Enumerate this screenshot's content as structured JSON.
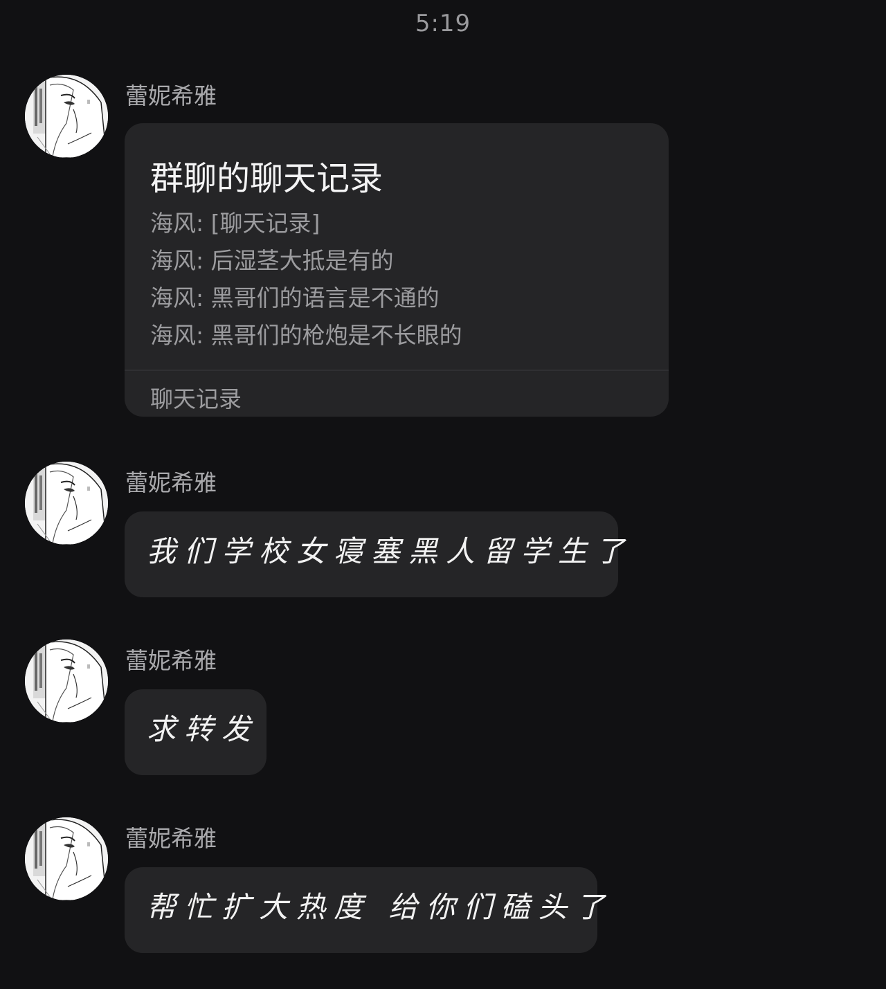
{
  "status": {
    "time": "5:19"
  },
  "messages": [
    {
      "sender": "蕾妮希雅",
      "type": "chat-record",
      "card": {
        "title": "群聊的聊天记录",
        "lines": [
          "海风: [聊天记录]",
          "海风: 后湿茎大抵是有的",
          "海风: 黑哥们的语言是不通的",
          "海风: 黑哥们的枪炮是不长眼的"
        ],
        "footer": "聊天记录"
      }
    },
    {
      "sender": "蕾妮希雅",
      "type": "text",
      "text": "我们学校女寝塞黑人留学生了"
    },
    {
      "sender": "蕾妮希雅",
      "type": "text",
      "text": "求转发"
    },
    {
      "sender": "蕾妮希雅",
      "type": "text",
      "text": "帮忙扩大热度 给你们磕头了"
    }
  ],
  "colors": {
    "background": "#111113",
    "bubble": "#252527",
    "sender_text": "#a9a9ac",
    "secondary_text": "#9c9c9f"
  },
  "icons": {
    "avatar": "manga-girl-avatar"
  }
}
